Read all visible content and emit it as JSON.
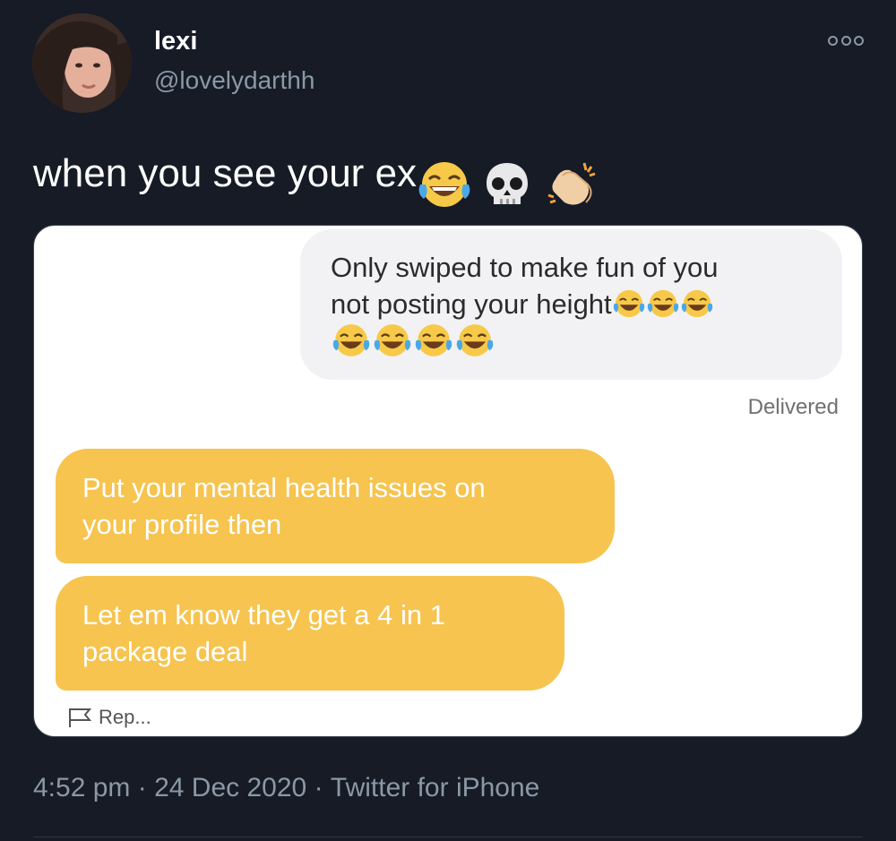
{
  "author": {
    "display_name": "lexi",
    "handle": "@lovelydarthh"
  },
  "tweet": {
    "text": "when you see your ex",
    "emojis": [
      "laughing-crying-icon",
      "skull-icon",
      "clapping-hands-icon"
    ]
  },
  "screenshot": {
    "sent_message_line1": "Only swiped to make fun of you",
    "sent_message_line2": "not posting your height",
    "sent_status": "Delivered",
    "received_message_1": "Put your mental health issues on your profile then",
    "received_message_1_line1": "Put your mental health issues on",
    "received_message_1_line2": "your profile then",
    "received_message_2_line1": "Let em know they get a 4 in 1",
    "received_message_2_line2": "package deal",
    "report_label": "Rep..."
  },
  "meta": {
    "time": "4:52 pm",
    "date": "24 Dec 2020",
    "source": "Twitter for iPhone",
    "separator": "·"
  },
  "colors": {
    "background": "#161b26",
    "sent_bubble": "#f2f2f4",
    "received_bubble": "#f6c44f",
    "muted_text": "#8b98a5"
  }
}
